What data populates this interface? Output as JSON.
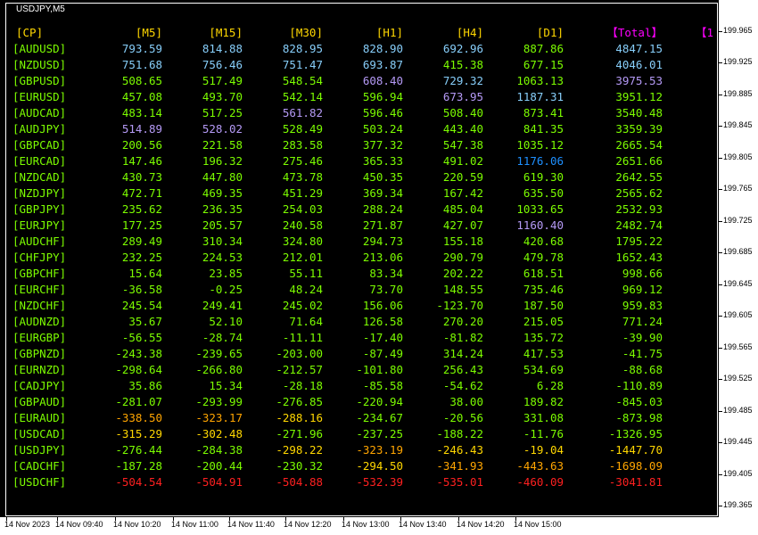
{
  "window": {
    "symbol_title": "USDJPY,M5"
  },
  "table": {
    "headers": [
      "[CP]",
      "[M5]",
      "[M15]",
      "[M30]",
      "[H1]",
      "[H4]",
      "[D1]",
      "【Total】",
      "【1"
    ],
    "header_colors": [
      "#ffd700",
      "#ffd700",
      "#ffd700",
      "#ffd700",
      "#ffd700",
      "#ffd700",
      "#ffd700",
      "#ff00ff",
      "#ff00ff"
    ],
    "rows": [
      {
        "pair": "[AUDUSD]",
        "values": [
          "793.59",
          "814.88",
          "828.95",
          "828.90",
          "692.96",
          "887.86",
          "4847.15"
        ],
        "colors": [
          "#87cefa",
          "#87cefa",
          "#87cefa",
          "#87cefa",
          "#87cefa",
          "#7cfc00",
          "#87cefa"
        ]
      },
      {
        "pair": "[NZDUSD]",
        "values": [
          "751.68",
          "756.46",
          "751.47",
          "693.87",
          "415.38",
          "677.15",
          "4046.01"
        ],
        "colors": [
          "#87cefa",
          "#87cefa",
          "#87cefa",
          "#87cefa",
          "#7cfc00",
          "#7cfc00",
          "#87cefa"
        ]
      },
      {
        "pair": "[GBPUSD]",
        "values": [
          "508.65",
          "517.49",
          "548.54",
          "608.40",
          "729.32",
          "1063.13",
          "3975.53"
        ],
        "colors": [
          "#7cfc00",
          "#7cfc00",
          "#7cfc00",
          "#b59af6",
          "#87cefa",
          "#7cfc00",
          "#b59af6"
        ]
      },
      {
        "pair": "[EURUSD]",
        "values": [
          "457.08",
          "493.70",
          "542.14",
          "596.94",
          "673.95",
          "1187.31",
          "3951.12"
        ],
        "colors": [
          "#7cfc00",
          "#7cfc00",
          "#7cfc00",
          "#7cfc00",
          "#b59af6",
          "#87cefa",
          "#7cfc00"
        ]
      },
      {
        "pair": "[AUDCAD]",
        "values": [
          "483.14",
          "517.25",
          "561.82",
          "596.46",
          "508.40",
          "873.41",
          "3540.48"
        ],
        "colors": [
          "#7cfc00",
          "#7cfc00",
          "#b59af6",
          "#7cfc00",
          "#7cfc00",
          "#7cfc00",
          "#7cfc00"
        ]
      },
      {
        "pair": "[AUDJPY]",
        "values": [
          "514.89",
          "528.02",
          "528.49",
          "503.24",
          "443.40",
          "841.35",
          "3359.39"
        ],
        "colors": [
          "#b59af6",
          "#b59af6",
          "#7cfc00",
          "#7cfc00",
          "#7cfc00",
          "#7cfc00",
          "#7cfc00"
        ]
      },
      {
        "pair": "[GBPCAD]",
        "values": [
          "200.56",
          "221.58",
          "283.58",
          "377.32",
          "547.38",
          "1035.12",
          "2665.54"
        ],
        "colors": [
          "#7cfc00",
          "#7cfc00",
          "#7cfc00",
          "#7cfc00",
          "#7cfc00",
          "#7cfc00",
          "#7cfc00"
        ]
      },
      {
        "pair": "[EURCAD]",
        "values": [
          "147.46",
          "196.32",
          "275.46",
          "365.33",
          "491.02",
          "1176.06",
          "2651.66"
        ],
        "colors": [
          "#7cfc00",
          "#7cfc00",
          "#7cfc00",
          "#7cfc00",
          "#7cfc00",
          "#1e90ff",
          "#7cfc00"
        ]
      },
      {
        "pair": "[NZDCAD]",
        "values": [
          "430.73",
          "447.80",
          "473.78",
          "450.35",
          "220.59",
          "619.30",
          "2642.55"
        ],
        "colors": [
          "#7cfc00",
          "#7cfc00",
          "#7cfc00",
          "#7cfc00",
          "#7cfc00",
          "#7cfc00",
          "#7cfc00"
        ]
      },
      {
        "pair": "[NZDJPY]",
        "values": [
          "472.71",
          "469.35",
          "451.29",
          "369.34",
          "167.42",
          "635.50",
          "2565.62"
        ],
        "colors": [
          "#7cfc00",
          "#7cfc00",
          "#7cfc00",
          "#7cfc00",
          "#7cfc00",
          "#7cfc00",
          "#7cfc00"
        ]
      },
      {
        "pair": "[GBPJPY]",
        "values": [
          "235.62",
          "236.35",
          "254.03",
          "288.24",
          "485.04",
          "1033.65",
          "2532.93"
        ],
        "colors": [
          "#7cfc00",
          "#7cfc00",
          "#7cfc00",
          "#7cfc00",
          "#7cfc00",
          "#7cfc00",
          "#7cfc00"
        ]
      },
      {
        "pair": "[EURJPY]",
        "values": [
          "177.25",
          "205.57",
          "240.58",
          "271.87",
          "427.07",
          "1160.40",
          "2482.74"
        ],
        "colors": [
          "#7cfc00",
          "#7cfc00",
          "#7cfc00",
          "#7cfc00",
          "#7cfc00",
          "#b59af6",
          "#7cfc00"
        ]
      },
      {
        "pair": "[AUDCHF]",
        "values": [
          "289.49",
          "310.34",
          "324.80",
          "294.73",
          "155.18",
          "420.68",
          "1795.22"
        ],
        "colors": [
          "#7cfc00",
          "#7cfc00",
          "#7cfc00",
          "#7cfc00",
          "#7cfc00",
          "#7cfc00",
          "#7cfc00"
        ]
      },
      {
        "pair": "[CHFJPY]",
        "values": [
          "232.25",
          "224.53",
          "212.01",
          "213.06",
          "290.79",
          "479.78",
          "1652.43"
        ],
        "colors": [
          "#7cfc00",
          "#7cfc00",
          "#7cfc00",
          "#7cfc00",
          "#7cfc00",
          "#7cfc00",
          "#7cfc00"
        ]
      },
      {
        "pair": "[GBPCHF]",
        "values": [
          "15.64",
          "23.85",
          "55.11",
          "83.34",
          "202.22",
          "618.51",
          "998.66"
        ],
        "colors": [
          "#7cfc00",
          "#7cfc00",
          "#7cfc00",
          "#7cfc00",
          "#7cfc00",
          "#7cfc00",
          "#7cfc00"
        ]
      },
      {
        "pair": "[EURCHF]",
        "values": [
          "-36.58",
          "-0.25",
          "48.24",
          "73.70",
          "148.55",
          "735.46",
          "969.12"
        ],
        "colors": [
          "#7cfc00",
          "#7cfc00",
          "#7cfc00",
          "#7cfc00",
          "#7cfc00",
          "#7cfc00",
          "#7cfc00"
        ]
      },
      {
        "pair": "[NZDCHF]",
        "values": [
          "245.54",
          "249.41",
          "245.02",
          "156.06",
          "-123.70",
          "187.50",
          "959.83"
        ],
        "colors": [
          "#7cfc00",
          "#7cfc00",
          "#7cfc00",
          "#7cfc00",
          "#7cfc00",
          "#7cfc00",
          "#7cfc00"
        ]
      },
      {
        "pair": "[AUDNZD]",
        "values": [
          "35.67",
          "52.10",
          "71.64",
          "126.58",
          "270.20",
          "215.05",
          "771.24"
        ],
        "colors": [
          "#7cfc00",
          "#7cfc00",
          "#7cfc00",
          "#7cfc00",
          "#7cfc00",
          "#7cfc00",
          "#7cfc00"
        ]
      },
      {
        "pair": "[EURGBP]",
        "values": [
          "-56.55",
          "-28.74",
          "-11.11",
          "-17.40",
          "-81.82",
          "135.72",
          "-39.90"
        ],
        "colors": [
          "#7cfc00",
          "#7cfc00",
          "#7cfc00",
          "#7cfc00",
          "#7cfc00",
          "#7cfc00",
          "#7cfc00"
        ]
      },
      {
        "pair": "[GBPNZD]",
        "values": [
          "-243.38",
          "-239.65",
          "-203.00",
          "-87.49",
          "314.24",
          "417.53",
          "-41.75"
        ],
        "colors": [
          "#7cfc00",
          "#7cfc00",
          "#7cfc00",
          "#7cfc00",
          "#7cfc00",
          "#7cfc00",
          "#7cfc00"
        ]
      },
      {
        "pair": "[EURNZD]",
        "values": [
          "-298.64",
          "-266.80",
          "-212.57",
          "-101.80",
          "256.43",
          "534.69",
          "-88.68"
        ],
        "colors": [
          "#7cfc00",
          "#7cfc00",
          "#7cfc00",
          "#7cfc00",
          "#7cfc00",
          "#7cfc00",
          "#7cfc00"
        ]
      },
      {
        "pair": "[CADJPY]",
        "values": [
          "35.86",
          "15.34",
          "-28.18",
          "-85.58",
          "-54.62",
          "6.28",
          "-110.89"
        ],
        "colors": [
          "#7cfc00",
          "#7cfc00",
          "#7cfc00",
          "#7cfc00",
          "#7cfc00",
          "#7cfc00",
          "#7cfc00"
        ]
      },
      {
        "pair": "[GBPAUD]",
        "values": [
          "-281.07",
          "-293.99",
          "-276.85",
          "-220.94",
          "38.00",
          "189.82",
          "-845.03"
        ],
        "colors": [
          "#7cfc00",
          "#7cfc00",
          "#7cfc00",
          "#7cfc00",
          "#7cfc00",
          "#7cfc00",
          "#7cfc00"
        ]
      },
      {
        "pair": "[EURAUD]",
        "values": [
          "-338.50",
          "-323.17",
          "-288.16",
          "-234.67",
          "-20.56",
          "331.08",
          "-873.98"
        ],
        "colors": [
          "#ffa500",
          "#ffa500",
          "#ffd700",
          "#7cfc00",
          "#7cfc00",
          "#7cfc00",
          "#7cfc00"
        ]
      },
      {
        "pair": "[USDCAD]",
        "values": [
          "-315.29",
          "-302.48",
          "-271.96",
          "-237.25",
          "-188.22",
          "-11.76",
          "-1326.95"
        ],
        "colors": [
          "#ffd700",
          "#ffd700",
          "#7cfc00",
          "#7cfc00",
          "#7cfc00",
          "#7cfc00",
          "#7cfc00"
        ]
      },
      {
        "pair": "[USDJPY]",
        "values": [
          "-276.44",
          "-284.38",
          "-298.22",
          "-323.19",
          "-246.43",
          "-19.04",
          "-1447.70"
        ],
        "colors": [
          "#7cfc00",
          "#7cfc00",
          "#ffd700",
          "#ffa500",
          "#ffd700",
          "#ffd700",
          "#ffd700"
        ]
      },
      {
        "pair": "[CADCHF]",
        "values": [
          "-187.28",
          "-200.44",
          "-230.32",
          "-294.50",
          "-341.93",
          "-443.63",
          "-1698.09"
        ],
        "colors": [
          "#7cfc00",
          "#7cfc00",
          "#7cfc00",
          "#ffd700",
          "#ffa500",
          "#ffa500",
          "#ffa500"
        ]
      },
      {
        "pair": "[USDCHF]",
        "values": [
          "-504.54",
          "-504.91",
          "-504.88",
          "-532.39",
          "-535.01",
          "-460.09",
          "-3041.81"
        ],
        "colors": [
          "#ff2020",
          "#ff2020",
          "#ff2020",
          "#ff2020",
          "#ff2020",
          "#ff2020",
          "#ff2020"
        ]
      }
    ]
  },
  "price_axis": {
    "labels": [
      "199.965",
      "199.925",
      "199.885",
      "199.845",
      "199.805",
      "199.765",
      "199.725",
      "199.685",
      "199.645",
      "199.605",
      "199.565",
      "199.525",
      "199.485",
      "199.445",
      "199.405",
      "199.365"
    ]
  },
  "time_axis": {
    "labels": [
      "14 Nov 2023",
      "14 Nov 09:40",
      "14 Nov 10:20",
      "14 Nov 11:00",
      "14 Nov 11:40",
      "14 Nov 12:20",
      "14 Nov 13:00",
      "14 Nov 13:40",
      "14 Nov 14:20",
      "14 Nov 15:00"
    ]
  }
}
